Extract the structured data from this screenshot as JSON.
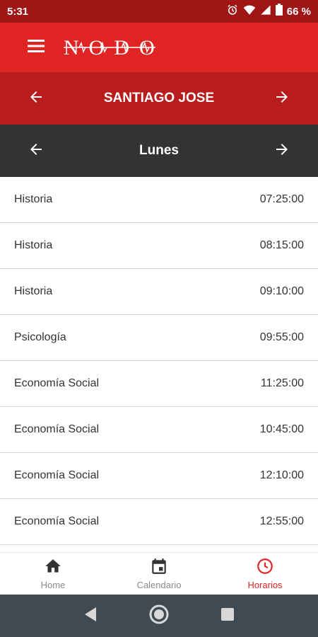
{
  "status_bar": {
    "time": "5:31",
    "battery": "66 %"
  },
  "app": {
    "logo_text": "NODOS"
  },
  "student": {
    "name": "SANTIAGO JOSE"
  },
  "day": {
    "name": "Lunes"
  },
  "schedule": [
    {
      "subject": "Historia",
      "time": "07:25:00"
    },
    {
      "subject": "Historia",
      "time": "08:15:00"
    },
    {
      "subject": "Historia",
      "time": "09:10:00"
    },
    {
      "subject": "Psicología",
      "time": "09:55:00"
    },
    {
      "subject": "Economía Social",
      "time": "11:25:00"
    },
    {
      "subject": "Economía Social",
      "time": "10:45:00"
    },
    {
      "subject": "Economía Social",
      "time": "12:10:00"
    },
    {
      "subject": "Economía Social",
      "time": "12:55:00"
    }
  ],
  "bottom_nav": {
    "home_label": "Home",
    "calendar_label": "Calendario",
    "schedule_label": "Horarios",
    "active": "Horarios"
  },
  "colors": {
    "primary": "#e02424",
    "status_bar": "#a01515",
    "student_bar": "#b81c1c",
    "day_bar": "#333333",
    "inactive_tab": "#8a8a8a"
  }
}
